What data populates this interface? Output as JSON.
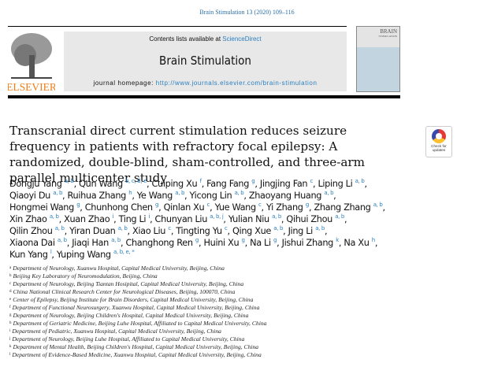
{
  "citation": "Brain Stimulation 13 (2020) 109–116",
  "banner": {
    "contents_prefix": "Contents lists available at ",
    "contents_link": "ScienceDirect",
    "journal_title": "Brain Stimulation",
    "homepage_prefix": "journal homepage: ",
    "homepage_url": "http://www.journals.elsevier.com/brain-stimulation"
  },
  "publisher_logo": "ELSEVIER",
  "cover": {
    "title": "BRAIN",
    "subtitle": "STIMULATION"
  },
  "badge_label": "Check for updates",
  "title": "Transcranial direct current stimulation reduces seizure frequency in patients with refractory focal epilepsy: A randomized, double-blind, sham-controlled, and three-arm parallel multicenter study",
  "authors": [
    [
      [
        "Dongju Yang",
        "a, b"
      ],
      [
        "Qun Wang",
        "b, c, d, e"
      ],
      [
        "Cuiping Xu",
        "f"
      ],
      [
        "Fang Fang",
        "g"
      ],
      [
        "Jingjing Fan",
        "c"
      ],
      [
        "Liping Li",
        "a, b"
      ]
    ],
    [
      [
        "Qiaoyi Du",
        "a, b"
      ],
      [
        "Ruihua Zhang",
        "h"
      ],
      [
        "Ye Wang",
        "a, b"
      ],
      [
        "Yicong Lin",
        "a, b"
      ],
      [
        "Zhaoyang Huang",
        "a, b"
      ]
    ],
    [
      [
        "Hongmei Wang",
        "g"
      ],
      [
        "Chunhong Chen",
        "g"
      ],
      [
        "Qinlan Xu",
        "c"
      ],
      [
        "Yue Wang",
        "c"
      ],
      [
        "Yi Zhang",
        "g"
      ],
      [
        "Zhang Zhang",
        "a, b"
      ]
    ],
    [
      [
        "Xin Zhao",
        "a, b"
      ],
      [
        "Xuan Zhao",
        "i"
      ],
      [
        "Ting Li",
        "i"
      ],
      [
        "Chunyan Liu",
        "a, b, j"
      ],
      [
        "Yulian Niu",
        "a, b"
      ],
      [
        "Qihui Zhou",
        "a, b"
      ]
    ],
    [
      [
        "Qilin Zhou",
        "a, b"
      ],
      [
        "Yiran Duan",
        "a, b"
      ],
      [
        "Xiao Liu",
        "c"
      ],
      [
        "Tingting Yu",
        "c"
      ],
      [
        "Qing Xue",
        "a, b"
      ],
      [
        "Jing Li",
        "a, b"
      ]
    ],
    [
      [
        "Xiaona Dai",
        "a, b"
      ],
      [
        "Jiaqi Han",
        "a, b"
      ],
      [
        "Changhong Ren",
        "g"
      ],
      [
        "Huini Xu",
        "g"
      ],
      [
        "Na Li",
        "g"
      ],
      [
        "Jishui Zhang",
        "k"
      ],
      [
        "Na Xu",
        "h"
      ]
    ],
    [
      [
        "Kun Yang",
        "l"
      ],
      [
        "Yuping Wang",
        "a, b, e, *"
      ]
    ]
  ],
  "affiliations": [
    [
      "a",
      "Department of Neurology, Xuanwu Hospital, Capital Medical University, Beijing, China"
    ],
    [
      "b",
      "Beijing Key Laboratory of Neuromodulation, Beijing, China"
    ],
    [
      "c",
      "Department of Neurology, Beijing Tiantan Hosipital, Capital Medical University, Beijing, China"
    ],
    [
      "d",
      "China National Clinical Research Center for Neurological Diseases, Beijing, 100070, China"
    ],
    [
      "e",
      "Center of Epilepsy, Beijing Institute for Brain Disorders, Capital Medical University, Beijing, China"
    ],
    [
      "f",
      "Department of Functional Neurosurgery, Xuanwu Hospital, Capital Medical University, Beijing, China"
    ],
    [
      "g",
      "Department of Neurology, Beijing Children's Hospital, Capital Medical University, Beijing, China"
    ],
    [
      "h",
      "Department of Geriatric Medicine, Beijing Luhe Hospital, Affiliated to Capital Medical University, China"
    ],
    [
      "i",
      "Department of Pediatric, Xuanwu Hospital, Capital Medical University, Beijing, China"
    ],
    [
      "j",
      "Department of Neurology, Beijing Luhe Hospital, Affiliated to Capital Medical University, China"
    ],
    [
      "k",
      "Department of Mental Health, Beijing Children's Hospital, Capital Medical University, Beijing, China"
    ],
    [
      "l",
      "Department of Evidence-Based Medicine, Xuanwu Hospital, Capital Medical University, Beijing, China"
    ]
  ],
  "colors": {
    "link": "#2a7fbf",
    "elsevier_orange": "#f07d1a",
    "banner_bg": "#e8e8e8"
  }
}
